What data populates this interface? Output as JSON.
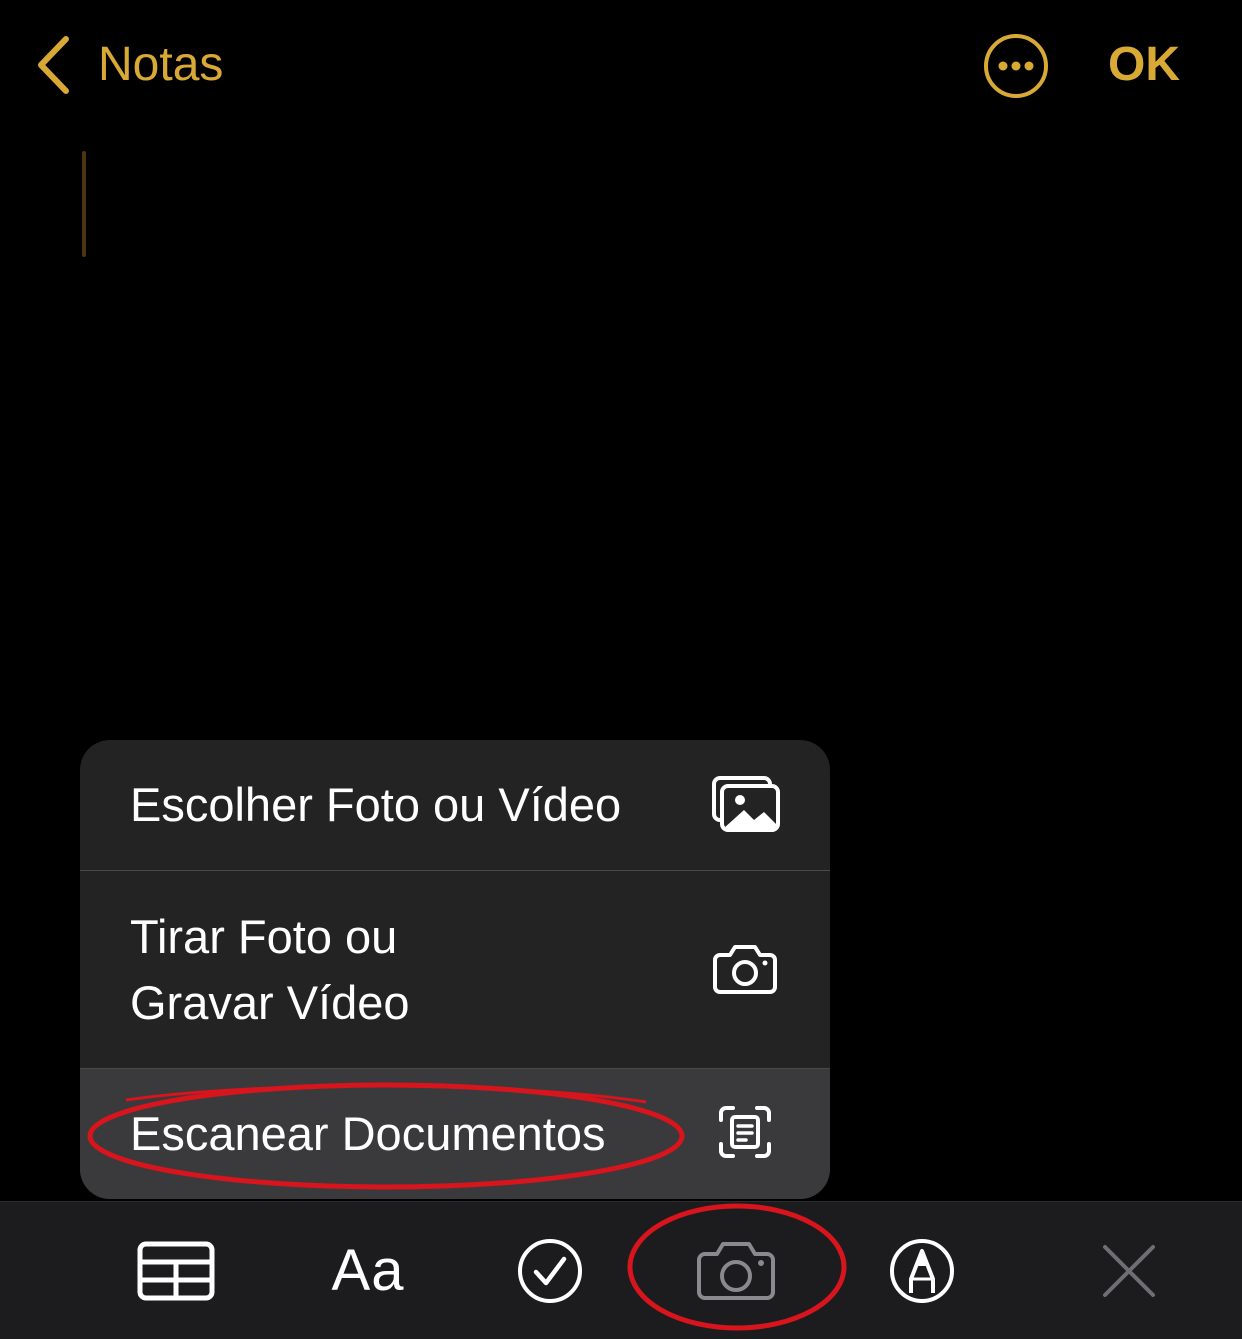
{
  "header": {
    "back_label": "Notas",
    "done_label": "OK",
    "back_icon": "chevron-left-icon",
    "more_icon": "ellipsis-circle-icon"
  },
  "menu": {
    "items": [
      {
        "lines": [
          "Escolher Foto ou Vídeo"
        ],
        "icon": "photo-library-icon"
      },
      {
        "lines": [
          "Tirar Foto ou",
          "Gravar Vídeo"
        ],
        "icon": "camera-icon"
      },
      {
        "lines": [
          "Escanear Documentos"
        ],
        "icon": "document-scanner-icon",
        "highlighted": true
      }
    ]
  },
  "toolbar": {
    "format_label": "Aa",
    "items": [
      "table-icon",
      "text-format-icon",
      "checklist-icon",
      "camera-icon",
      "markup-icon",
      "close-icon"
    ]
  },
  "colors": {
    "accent": "#D9A936",
    "background": "#000000",
    "menu_background": "#232323",
    "menu_highlight": "#3a3a3c",
    "toolbar_background": "#1c1c1e",
    "annotation": "#d8141c"
  }
}
